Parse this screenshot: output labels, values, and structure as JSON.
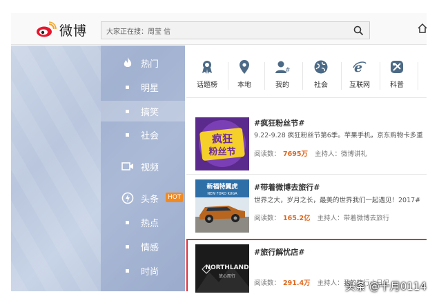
{
  "header": {
    "logo_text": "微博",
    "search_placeholder": "大家正在搜：周莹 信"
  },
  "sidebar": {
    "items": [
      {
        "label": "热门",
        "icon": "fire-icon"
      },
      {
        "label": "明星"
      },
      {
        "label": "搞笑",
        "active": true
      },
      {
        "label": "社会"
      },
      {
        "label": "视频",
        "icon": "video-icon"
      },
      {
        "label": "头条",
        "icon": "headline-icon",
        "badge": "HOT"
      },
      {
        "label": "热点"
      },
      {
        "label": "情感"
      },
      {
        "label": "时尚"
      }
    ]
  },
  "categories": [
    {
      "label": "话题榜",
      "icon": "ribbon-icon"
    },
    {
      "label": "本地",
      "icon": "location-pin-icon"
    },
    {
      "label": "我的",
      "icon": "user-icon"
    },
    {
      "label": "社会",
      "icon": "globe-icon"
    },
    {
      "label": "互联网",
      "icon": "ie-icon"
    },
    {
      "label": "科普",
      "icon": "science-icon"
    }
  ],
  "topics": [
    {
      "title": "#疯狂粉丝节#",
      "desc": "9.22-9.28 疯狂粉丝节第6季。苹果手机，京东购物卡多重",
      "reads_label": "阅读数：",
      "reads": "7695万",
      "host_label": "主持人：",
      "host": "微博讲礼",
      "thumb_text_1": "疯狂",
      "thumb_text_2": "粉丝节"
    },
    {
      "title": "#带着微博去旅行#",
      "desc": "世界之大，岁月之长，最美的世界我们一起遇见！2017#",
      "reads_label": "阅读数：",
      "reads": "165.2亿",
      "host_label": "主持人：",
      "host": "带着微博去旅行",
      "thumb_text_1": "新福特翼虎",
      "thumb_text_2": "NEW FORD KUGA"
    },
    {
      "title": "#旅行解忧店#",
      "desc": "",
      "reads_label": "阅读数：",
      "reads": "291.4万",
      "host_label": "主持人：",
      "host": "我的旅行小日记",
      "thumb_text_1": "NORTHLAND",
      "thumb_text_2": "放心而行"
    }
  ],
  "watermark": "头条 @十月0114",
  "colors": {
    "accent_orange": "#e0661b",
    "hot_badge": "#f08a24",
    "highlight_border": "#e1303a",
    "weibo_red": "#e6162d"
  }
}
